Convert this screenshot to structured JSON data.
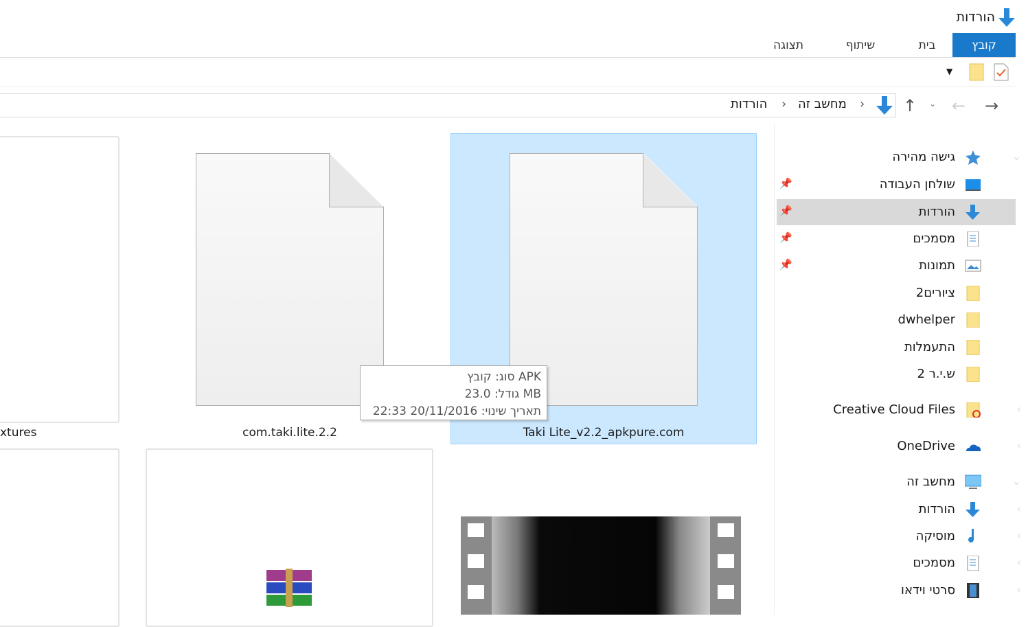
{
  "window": {
    "title": "הורדות"
  },
  "ribbon": {
    "tabs": [
      {
        "label": "קובץ",
        "active": true
      },
      {
        "label": "בית"
      },
      {
        "label": "שיתוף"
      },
      {
        "label": "תצוגה"
      }
    ]
  },
  "address": {
    "crumbs": [
      "מחשב זה",
      "הורדות"
    ]
  },
  "sidebar": {
    "items": [
      {
        "label": "גישה מהירה",
        "icon": "star-icon"
      },
      {
        "label": "שולחן העבודה",
        "icon": "desktop-icon",
        "pinned": true
      },
      {
        "label": "הורדות",
        "icon": "download-icon",
        "pinned": true,
        "selected": true
      },
      {
        "label": "מסמכים",
        "icon": "documents-icon",
        "pinned": true
      },
      {
        "label": "תמונות",
        "icon": "pictures-icon",
        "pinned": true
      },
      {
        "label": "ציורים2",
        "icon": "folder-icon"
      },
      {
        "label": "dwhelper",
        "icon": "folder-icon"
      },
      {
        "label": "התעמלות",
        "icon": "folder-icon"
      },
      {
        "label": "ש.י.ר 2",
        "icon": "folder-icon"
      },
      {
        "label": "Creative Cloud Files",
        "icon": "creative-cloud-icon"
      },
      {
        "label": "OneDrive",
        "icon": "onedrive-icon"
      },
      {
        "label": "מחשב זה",
        "icon": "computer-icon"
      },
      {
        "label": "הורדות",
        "icon": "download-icon"
      },
      {
        "label": "מוסיקה",
        "icon": "music-icon"
      },
      {
        "label": "מסמכים",
        "icon": "documents-icon"
      },
      {
        "label": "סרטי וידאו",
        "icon": "video-icon"
      }
    ]
  },
  "files": [
    {
      "name": "xtures"
    },
    {
      "name": "com.taki.lite.2.2"
    },
    {
      "name": "Taki Lite_v2.2_apkpure.com",
      "selected": true
    }
  ],
  "tooltip": {
    "type": "סוג: קובץ APK",
    "size": "גודל: 23.0 MB",
    "modified": "תאריך שינוי: 20/11/2016 22:33"
  },
  "colors": {
    "accent": "#1979ca",
    "selection": "#cce8ff",
    "selection_border": "#99d1ff"
  }
}
